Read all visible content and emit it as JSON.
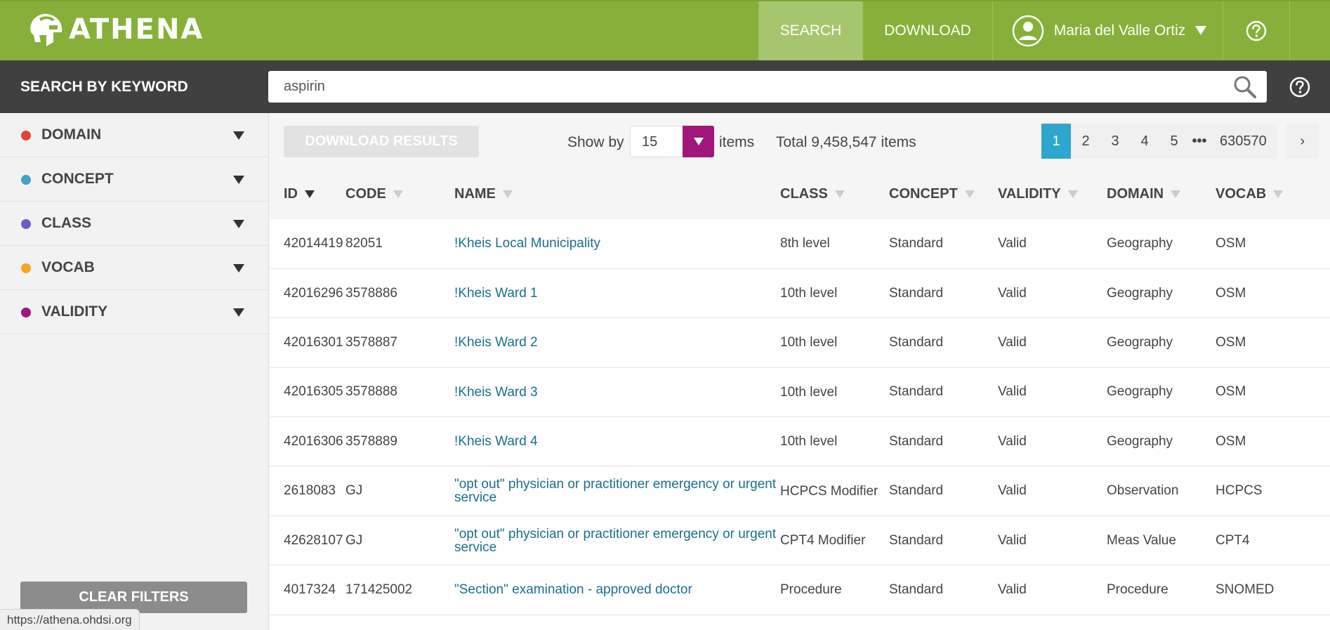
{
  "header": {
    "logo_text": "ATHENA",
    "nav": {
      "search": "SEARCH",
      "download": "DOWNLOAD",
      "user": "Maria del Valle Ortiz"
    }
  },
  "search": {
    "label": "SEARCH BY KEYWORD",
    "value": "aspirin"
  },
  "sidebar": {
    "filters": [
      {
        "label": "DOMAIN",
        "color": "#e8413b"
      },
      {
        "label": "CONCEPT",
        "color": "#3fa3c4"
      },
      {
        "label": "CLASS",
        "color": "#6a5ccf"
      },
      {
        "label": "VOCAB",
        "color": "#f5a623"
      },
      {
        "label": "VALIDITY",
        "color": "#a1167a"
      }
    ],
    "clear_label": "CLEAR FILTERS"
  },
  "status_url": "https://athena.ohdsi.org",
  "toolbar": {
    "download_results": "DOWNLOAD RESULTS",
    "show_by": "Show by",
    "per_page": "15",
    "items": "items",
    "total": "Total 9,458,547 items"
  },
  "pagination": {
    "pages": [
      "1",
      "2",
      "3",
      "4",
      "5"
    ],
    "ellipsis": "•••",
    "last": "630570",
    "next": "›"
  },
  "table": {
    "columns": [
      "ID",
      "CODE",
      "NAME",
      "CLASS",
      "CONCEPT",
      "VALIDITY",
      "DOMAIN",
      "VOCAB"
    ],
    "rows": [
      [
        "42014419",
        "82051",
        "!Kheis Local Municipality",
        "8th level",
        "Standard",
        "Valid",
        "Geography",
        "OSM"
      ],
      [
        "42016296",
        "3578886",
        "!Kheis Ward 1",
        "10th level",
        "Standard",
        "Valid",
        "Geography",
        "OSM"
      ],
      [
        "42016301",
        "3578887",
        "!Kheis Ward 2",
        "10th level",
        "Standard",
        "Valid",
        "Geography",
        "OSM"
      ],
      [
        "42016305",
        "3578888",
        "!Kheis Ward 3",
        "10th level",
        "Standard",
        "Valid",
        "Geography",
        "OSM"
      ],
      [
        "42016306",
        "3578889",
        "!Kheis Ward 4",
        "10th level",
        "Standard",
        "Valid",
        "Geography",
        "OSM"
      ],
      [
        "2618083",
        "GJ",
        "\"opt out\" physician or practitioner emergency or urgent service",
        "HCPCS Modifier",
        "Standard",
        "Valid",
        "Observation",
        "HCPCS"
      ],
      [
        "42628107",
        "GJ",
        "\"opt out\" physician or practitioner emergency or urgent service",
        "CPT4 Modifier",
        "Standard",
        "Valid",
        "Meas Value",
        "CPT4"
      ],
      [
        "4017324",
        "171425002",
        "\"Section\" examination - approved doctor",
        "Procedure",
        "Standard",
        "Valid",
        "Procedure",
        "SNOMED"
      ]
    ]
  }
}
